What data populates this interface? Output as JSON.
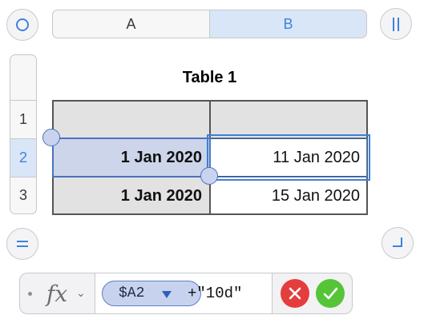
{
  "columns": [
    {
      "label": "A",
      "selected": false
    },
    {
      "label": "B",
      "selected": true
    }
  ],
  "rows": [
    {
      "label": "",
      "selected": false
    },
    {
      "label": "1",
      "selected": false
    },
    {
      "label": "2",
      "selected": true
    },
    {
      "label": "3",
      "selected": false
    }
  ],
  "table": {
    "title": "Table 1",
    "cells": {
      "r1c1": "",
      "r1c2": "",
      "r2c1": "1 Jan 2020",
      "r2c2": "11 Jan 2020",
      "r3c1": "1 Jan 2020",
      "r3c2": "15 Jan 2020"
    },
    "active_cell": "B2",
    "referenced_cell": "A2"
  },
  "formula_bar": {
    "fx_label": "fx",
    "chevron": "⌄",
    "token_text": "$A2",
    "formula_rest": "+\"10d\""
  },
  "icons": {
    "top_left": "select-table-icon",
    "top_right": "freeze-columns-icon",
    "bottom_left": "freeze-rows-icon",
    "bottom_right": "resize-table-icon",
    "cancel": "cancel-icon",
    "accept": "accept-icon"
  },
  "colors": {
    "accent": "#3f82de",
    "selection_fill": "#d8e6f7",
    "header_fill": "#e2e2e2",
    "cancel": "#e43d3d",
    "accept": "#55c437"
  }
}
